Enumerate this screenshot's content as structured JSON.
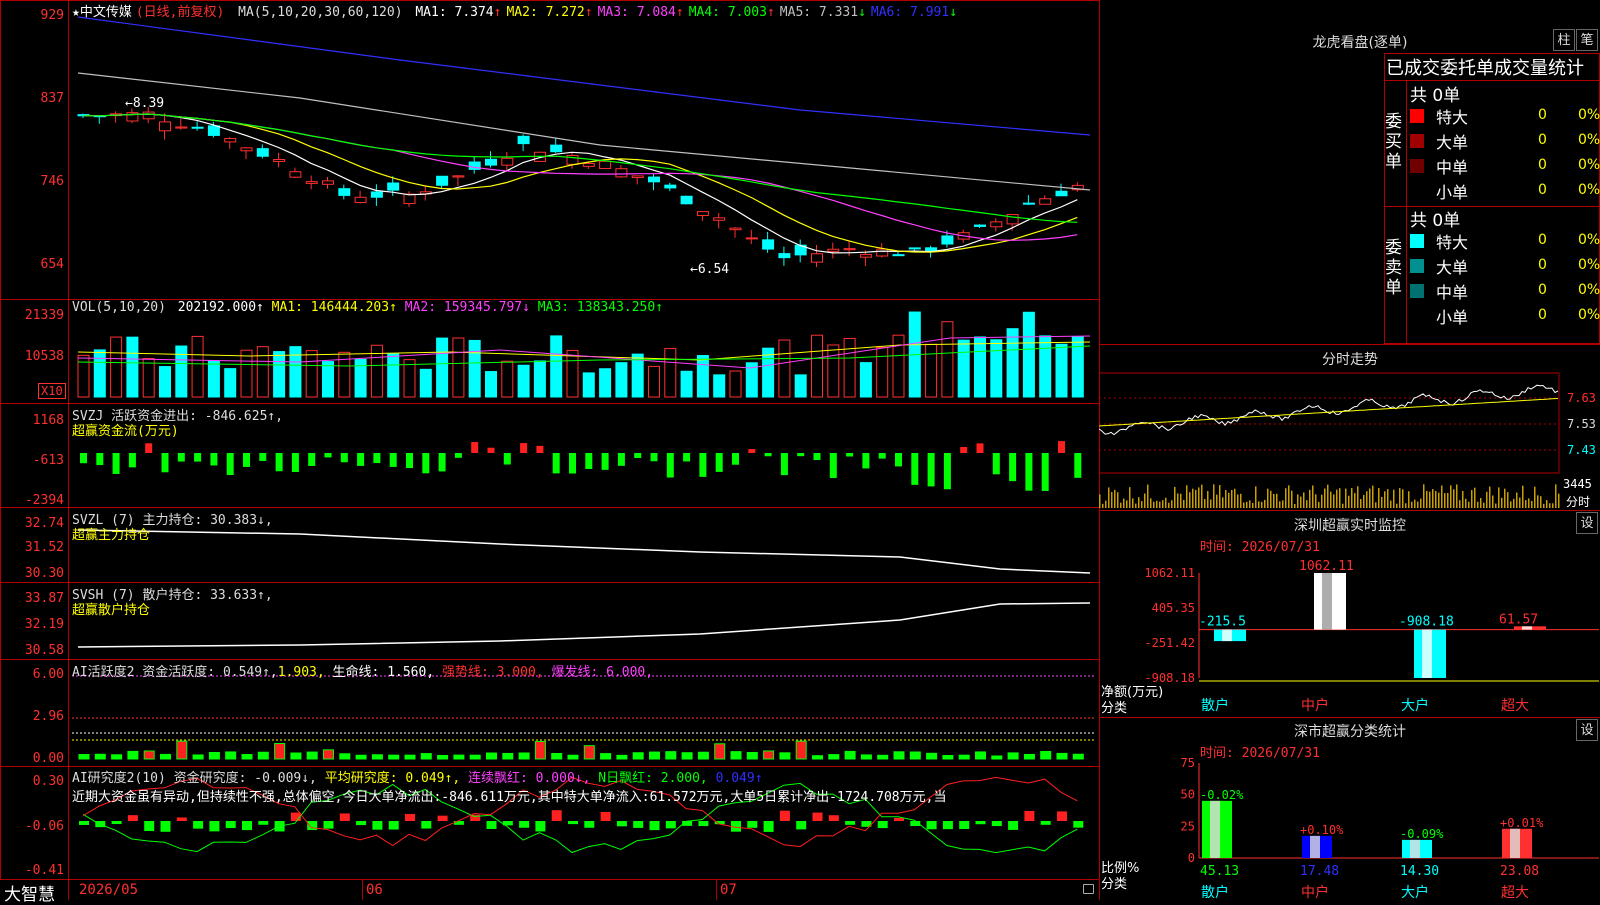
{
  "stock": {
    "name": "中文传媒",
    "period": "(日线,前复权)",
    "ma_label": "MA(5,10,20,30,60,120)",
    "ma_values": [
      {
        "label": "MA1: 7.374",
        "arrow": "↑",
        "color": "#ffffff"
      },
      {
        "label": "MA2: 7.272",
        "arrow": "↑",
        "color": "#ffff00"
      },
      {
        "label": "MA3: 7.084",
        "arrow": "↑",
        "color": "#ff40ff"
      },
      {
        "label": "MA4: 7.003",
        "arrow": "↑",
        "color": "#00ff00"
      },
      {
        "label": "MA5: 7.331",
        "arrow": "↓",
        "color": "#c0c0c0"
      },
      {
        "label": "MA6: 7.991",
        "arrow": "↓",
        "color": "#3030ff"
      }
    ],
    "high_marker": "8.39",
    "low_marker": "6.54",
    "price_axis": [
      "929",
      "837",
      "746",
      "654"
    ]
  },
  "volume": {
    "label": "VOL(5,10,20)",
    "value": "202192.000↑",
    "ma1": "MA1: 146444.203↑",
    "ma2": "MA2: 159345.797↓",
    "ma3": "MA3: 138343.250↑",
    "axis": [
      "21339",
      "10538"
    ],
    "unit": "X10"
  },
  "svzj": {
    "label": "SVZJ  活跃资金进出: -846.625↑,",
    "sub": "超赢资金流(万元)",
    "axis": [
      "1168",
      "-613",
      "-2394"
    ]
  },
  "svzl": {
    "label": "SVZL (7) 主力持仓: 30.383↓,",
    "sub": "超赢主力持仓",
    "axis": [
      "32.74",
      "31.52",
      "30.30"
    ]
  },
  "svsh": {
    "label": "SVSH (7) 散户持仓: 33.633↑,",
    "sub": "超赢散户持仓",
    "axis": [
      "33.87",
      "32.19",
      "30.58"
    ]
  },
  "ai_active": {
    "label_a": "AI活跃度2 资金活跃度: 0.549↑,",
    "label_b": "1.903,",
    "label_c": "生命线: 1.560,",
    "label_d": "强势线: 3.000,",
    "label_e": "爆发线: 6.000,",
    "axis": [
      "6.00",
      "2.96",
      "0.00"
    ]
  },
  "ai_research": {
    "label_a": "AI研究度2(10) 资金研究度: -0.009↓,",
    "label_b": "平均研究度: 0.049↑,",
    "label_c": "连续飘红: 0.000↓,",
    "label_d": "N日飘红: 2.000,",
    "label_e": "0.049↑",
    "comment": "近期大资金虽有异动,但持续性不强,总体偏空,今日大单净流出:-846.611万元,其中特大单净流入:61.572万元,大单5日累计净出-1724.708万元,当",
    "axis": [
      "0.30",
      "-0.06",
      "-0.41"
    ]
  },
  "dates": [
    "2026/05",
    "06",
    "07"
  ],
  "brand": "大智慧",
  "right": {
    "dragon_title": "龙虎看盘(逐单)",
    "btn_zhu": "柱",
    "btn_bi": "笔",
    "stat_title": "已成交委托单成交量统计",
    "buy_side": "委买单",
    "sell_side": "委卖单",
    "buy_total": "共 0单",
    "sell_total": "共 0单",
    "buy_rows": [
      {
        "name": "特大",
        "qty": "0",
        "pct": "0%",
        "color": "#ff0000"
      },
      {
        "name": "大单",
        "qty": "0",
        "pct": "0%",
        "color": "#a00000"
      },
      {
        "name": "中单",
        "qty": "0",
        "pct": "0%",
        "color": "#700000"
      },
      {
        "name": "小单",
        "qty": "0",
        "pct": "0%",
        "color": "#000000"
      }
    ],
    "sell_rows": [
      {
        "name": "特大",
        "qty": "0",
        "pct": "0%",
        "color": "#00ffff"
      },
      {
        "name": "大单",
        "qty": "0",
        "pct": "0%",
        "color": "#009090"
      },
      {
        "name": "中单",
        "qty": "0",
        "pct": "0%",
        "color": "#007070"
      },
      {
        "name": "小单",
        "qty": "0",
        "pct": "0%",
        "color": "#000000"
      }
    ],
    "intraday_title": "分时走势",
    "intraday_axis": [
      "7.63",
      "7.53",
      "7.43"
    ],
    "intraday_vol": "3445",
    "intraday_vol_label": "分时",
    "monitor_title": "深圳超赢实时监控",
    "monitor_btn": "设",
    "monitor_time": "时间: 2026/07/31",
    "monitor_axis": [
      "1062.11",
      "405.35",
      "-251.42",
      "-908.18"
    ],
    "monitor_ylabel": "净额(万元)",
    "monitor_xlabel": "分类",
    "class_title": "深市超赢分类统计",
    "class_btn": "设",
    "class_time": "时间: 2026/07/31",
    "class_axis": [
      "75",
      "50",
      "25",
      "0"
    ],
    "class_ylabel": "比例%",
    "class_xlabel": "分类"
  },
  "chart_data": [
    {
      "type": "bar",
      "title": "深圳超赢实时监控",
      "categories": [
        "散户",
        "中户",
        "大户",
        "超大"
      ],
      "values": [
        -215.5,
        1062.11,
        -908.18,
        61.57
      ],
      "ylabel": "净额(万元)",
      "ylim": [
        -908.18,
        1062.11
      ]
    },
    {
      "type": "bar",
      "title": "深市超赢分类统计",
      "categories": [
        "散户",
        "中户",
        "大户",
        "超大"
      ],
      "values": [
        45.13,
        17.48,
        14.3,
        23.08
      ],
      "changes": [
        "-0.02%",
        "+0.10%",
        "-0.09%",
        "+0.01%"
      ],
      "ylabel": "比例%",
      "ylim": [
        0,
        75
      ]
    }
  ],
  "colors": {
    "up": "#ff3030",
    "down": "#00ffff",
    "grid": "#b00000"
  }
}
